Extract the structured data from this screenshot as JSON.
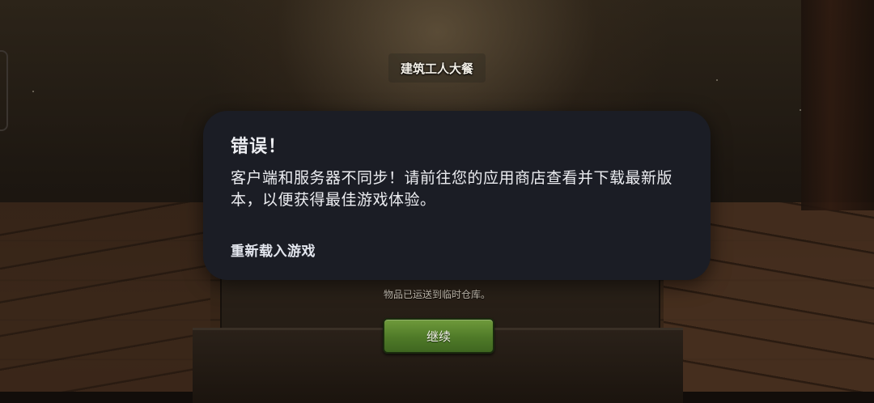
{
  "game": {
    "title": "建筑工人大餐",
    "stash_note": "物品已运送到临时仓库。",
    "continue_label": "继续"
  },
  "dialog": {
    "title": "错误！",
    "message": "客户端和服务器不同步！请前往您的应用商店查看并下载最新版本，以便获得最佳游戏体验。",
    "action_label": "重新载入游戏"
  },
  "colors": {
    "dialog_background": "#1b1d25",
    "dialog_text": "#ecedf1",
    "continue_button": "#5a8a2f"
  }
}
